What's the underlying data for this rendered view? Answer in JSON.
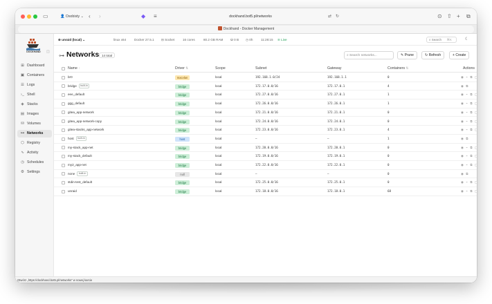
{
  "browser": {
    "profile": "Osobisty",
    "url": "dockhand.bot5.pl/networks",
    "tab_title": "Dockhand - Docker Management"
  },
  "app": {
    "logo_text": "DOCKHAND"
  },
  "sidebar": {
    "items": [
      {
        "label": "Dashboard",
        "icon": "dashboard-icon"
      },
      {
        "label": "Containers",
        "icon": "containers-icon"
      },
      {
        "label": "Logs",
        "icon": "logs-icon"
      },
      {
        "label": "Shell",
        "icon": "terminal-icon"
      },
      {
        "label": "Stacks",
        "icon": "stacks-icon"
      },
      {
        "label": "Images",
        "icon": "images-icon"
      },
      {
        "label": "Volumes",
        "icon": "volumes-icon"
      },
      {
        "label": "Networks",
        "icon": "networks-icon",
        "active": true
      },
      {
        "label": "Registry",
        "icon": "registry-icon"
      },
      {
        "label": "Activity",
        "icon": "activity-icon"
      },
      {
        "label": "Schedules",
        "icon": "schedules-icon"
      },
      {
        "label": "Settings",
        "icon": "settings-icon"
      }
    ]
  },
  "status": {
    "host": "unraid (local)",
    "os": "linux x64",
    "docker": "Docker 27.5.1",
    "socket": "Socket",
    "cores": "16 cores",
    "ram": "80.2 GB RAM",
    "disk": "0 B",
    "uptime": "0h",
    "time": "11:28:15",
    "live": "Live",
    "search_label": "Search",
    "search_shortcut": "⌘K"
  },
  "header": {
    "title": "Networks",
    "count": "14 total",
    "search_placeholder": "Search networks...",
    "prune": "Prune",
    "refresh": "Refresh",
    "create": "Create"
  },
  "table": {
    "columns": {
      "name": "Name",
      "driver": "Driver",
      "scope": "Scope",
      "subnet": "Subnet",
      "gateway": "Gateway",
      "containers": "Containers",
      "actions": "Actions"
    },
    "rows": [
      {
        "name": "br0",
        "builtin": "",
        "driver": "macvlan",
        "scope": "local",
        "subnet": "192.168.1.0/24",
        "gateway": "192.168.1.1",
        "containers": "0"
      },
      {
        "name": "bridge",
        "builtin": "built-in",
        "driver": "bridge",
        "scope": "local",
        "subnet": "172.17.0.0/16",
        "gateway": "172.17.0.1",
        "containers": "4"
      },
      {
        "name": "eee_default",
        "builtin": "",
        "driver": "bridge",
        "scope": "local",
        "subnet": "172.27.0.0/16",
        "gateway": "172.27.0.1",
        "containers": "1"
      },
      {
        "name": "ggg_default",
        "builtin": "",
        "driver": "bridge",
        "scope": "local",
        "subnet": "172.26.0.0/16",
        "gateway": "172.26.0.1",
        "containers": "1"
      },
      {
        "name": "gitea_app-network",
        "builtin": "",
        "driver": "bridge",
        "scope": "local",
        "subnet": "172.21.0.0/16",
        "gateway": "172.21.0.1",
        "containers": "0"
      },
      {
        "name": "gitea_app-network-copy",
        "builtin": "",
        "driver": "bridge",
        "scope": "local",
        "subnet": "172.24.0.0/16",
        "gateway": "172.24.0.1",
        "containers": "0"
      },
      {
        "name": "gitea-stacks_app-network",
        "builtin": "",
        "driver": "bridge",
        "scope": "local",
        "subnet": "172.23.0.0/16",
        "gateway": "172.23.0.1",
        "containers": "4"
      },
      {
        "name": "host",
        "builtin": "built-in",
        "driver": "host",
        "scope": "local",
        "subnet": "–",
        "gateway": "–",
        "containers": "1"
      },
      {
        "name": "my-stack_app-net",
        "builtin": "",
        "driver": "bridge",
        "scope": "local",
        "subnet": "172.20.0.0/16",
        "gateway": "172.20.0.1",
        "containers": "0"
      },
      {
        "name": "my-stack_default",
        "builtin": "",
        "driver": "bridge",
        "scope": "local",
        "subnet": "172.19.0.0/16",
        "gateway": "172.19.0.1",
        "containers": "0"
      },
      {
        "name": "my2_app-net",
        "builtin": "",
        "driver": "bridge",
        "scope": "local",
        "subnet": "172.22.0.0/16",
        "gateway": "172.22.0.1",
        "containers": "0"
      },
      {
        "name": "none",
        "builtin": "built-in",
        "driver": "null",
        "scope": "local",
        "subnet": "–",
        "gateway": "–",
        "containers": "0"
      },
      {
        "name": "stdin-test_default",
        "builtin": "",
        "driver": "bridge",
        "scope": "local",
        "subnet": "172.25.0.0/16",
        "gateway": "172.25.0.1",
        "containers": "0"
      },
      {
        "name": "unraid",
        "builtin": "",
        "driver": "bridge",
        "scope": "local",
        "subnet": "172.18.0.0/16",
        "gateway": "172.18.0.1",
        "containers": "68"
      }
    ]
  },
  "hover_status": "Otwórz „https://dockhand.bot5.pl/networks” w nowej karcie"
}
